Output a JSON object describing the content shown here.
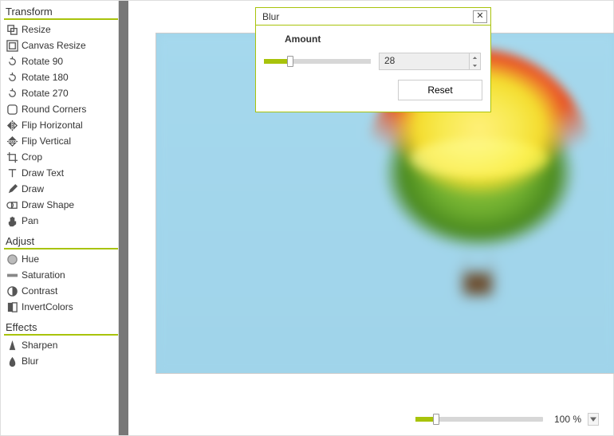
{
  "sidebar": {
    "sections": [
      {
        "title": "Transform",
        "items": [
          {
            "label": "Resize",
            "icon": "resize-icon"
          },
          {
            "label": "Canvas Resize",
            "icon": "canvas-resize-icon"
          },
          {
            "label": "Rotate 90",
            "icon": "rotate-icon"
          },
          {
            "label": "Rotate 180",
            "icon": "rotate-icon"
          },
          {
            "label": "Rotate 270",
            "icon": "rotate-icon"
          },
          {
            "label": "Round Corners",
            "icon": "round-corners-icon"
          },
          {
            "label": "Flip Horizontal",
            "icon": "flip-horizontal-icon"
          },
          {
            "label": "Flip Vertical",
            "icon": "flip-vertical-icon"
          },
          {
            "label": "Crop",
            "icon": "crop-icon"
          },
          {
            "label": "Draw Text",
            "icon": "draw-text-icon"
          },
          {
            "label": "Draw",
            "icon": "draw-icon"
          },
          {
            "label": "Draw Shape",
            "icon": "draw-shape-icon"
          },
          {
            "label": "Pan",
            "icon": "pan-icon"
          }
        ]
      },
      {
        "title": "Adjust",
        "items": [
          {
            "label": "Hue",
            "icon": "hue-icon"
          },
          {
            "label": "Saturation",
            "icon": "saturation-icon"
          },
          {
            "label": "Contrast",
            "icon": "contrast-icon"
          },
          {
            "label": "InvertColors",
            "icon": "invert-icon"
          }
        ]
      },
      {
        "title": "Effects",
        "items": [
          {
            "label": "Sharpen",
            "icon": "sharpen-icon"
          },
          {
            "label": "Blur",
            "icon": "blur-icon"
          }
        ]
      }
    ]
  },
  "dialog": {
    "title": "Blur",
    "param_label": "Amount",
    "value": "28",
    "slider_percent": 22,
    "reset_label": "Reset",
    "close_glyph": "✕"
  },
  "zoom": {
    "label": "100 %",
    "slider_percent": 14
  },
  "accent": "#a8c30b"
}
